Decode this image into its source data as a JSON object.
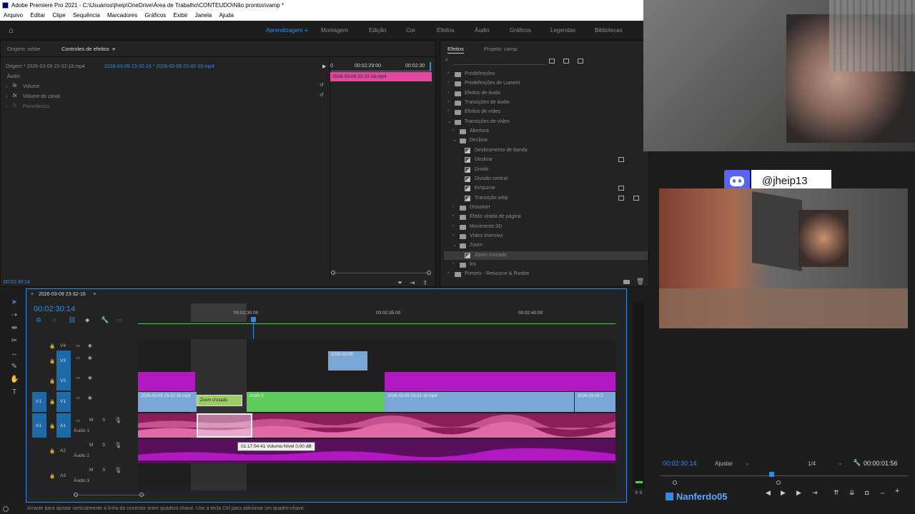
{
  "window": {
    "title": "Adobe Premiere Pro 2021 - C:\\Usuários\\jheip\\OneDrive\\Área de Trabalho\\CONTEUDO\\Não prontos\\vamp *"
  },
  "menu": [
    "Arquivo",
    "Editar",
    "Clipe",
    "Sequência",
    "Marcadores",
    "Gráficos",
    "Exibir",
    "Janela",
    "Ajuda"
  ],
  "workspaces": {
    "active": "Aprendizagem",
    "items": [
      "Montagem",
      "Edição",
      "Cor",
      "Efeitos",
      "Áudio",
      "Gráficos",
      "Legendas",
      "Bibliotecas"
    ]
  },
  "effect_controls": {
    "tab_source": "Origem: white",
    "tab_controls": "Controles de efeitos",
    "source_clip": "Origem * 2026-03-09 23-32-16.mp4",
    "seq_clip": "2026-03-09 23-32-16 * 2026-03-09 23-32-16.mp4",
    "section": "Áudio",
    "rows": [
      "Volume",
      "Volume do canal",
      "Panorâmico"
    ],
    "fx_label": "fx",
    "ruler_start": "0",
    "ruler_mid": "00:02:29:00",
    "ruler_end": "00:02:30",
    "clip_name": "2026-03-09 23-32-16.mp4",
    "time": "00:02:30:14"
  },
  "effects_panel": {
    "tab_effects": "Efeitos",
    "tab_project": "Projeto: vamp",
    "tree": [
      {
        "label": "Predefinições",
        "level": 0,
        "type": "folder",
        "expanded": false
      },
      {
        "label": "Predefinições de Lumetri",
        "level": 0,
        "type": "folder",
        "expanded": false
      },
      {
        "label": "Efeitos de áudio",
        "level": 0,
        "type": "folder",
        "expanded": false
      },
      {
        "label": "Transições de áudio",
        "level": 0,
        "type": "folder",
        "expanded": false
      },
      {
        "label": "Efeitos de vídeo",
        "level": 0,
        "type": "folder",
        "expanded": false
      },
      {
        "label": "Transições de vídeo",
        "level": 0,
        "type": "folder",
        "expanded": true
      },
      {
        "label": "Abertura",
        "level": 1,
        "type": "folder",
        "expanded": false
      },
      {
        "label": "Deslizar",
        "level": 1,
        "type": "folder",
        "expanded": true
      },
      {
        "label": "Deslizamento de banda",
        "level": 2,
        "type": "preset",
        "acc": 0
      },
      {
        "label": "Deslizar",
        "level": 2,
        "type": "preset",
        "acc": 1
      },
      {
        "label": "Dividir",
        "level": 2,
        "type": "preset",
        "acc": 0
      },
      {
        "label": "Divisão central",
        "level": 2,
        "type": "preset",
        "acc": 0
      },
      {
        "label": "Empurrar",
        "level": 2,
        "type": "preset",
        "acc": 1
      },
      {
        "label": "Transição whip",
        "level": 2,
        "type": "preset",
        "acc": 2
      },
      {
        "label": "Dissolver",
        "level": 1,
        "type": "folder",
        "expanded": false
      },
      {
        "label": "Efeito virada de página",
        "level": 1,
        "type": "folder",
        "expanded": false
      },
      {
        "label": "Movimento 3D",
        "level": 1,
        "type": "folder",
        "expanded": false
      },
      {
        "label": "Vídeo imersivo",
        "level": 1,
        "type": "folder",
        "expanded": false
      },
      {
        "label": "Zoom",
        "level": 1,
        "type": "folder",
        "expanded": true
      },
      {
        "label": "Zoom cruzado",
        "level": 2,
        "type": "preset",
        "acc": 0,
        "selected": true
      },
      {
        "label": "Íris",
        "level": 1,
        "type": "folder",
        "expanded": false
      },
      {
        "label": "Presets - Resource & Rookie",
        "level": 0,
        "type": "folder",
        "expanded": false
      }
    ]
  },
  "timeline": {
    "sequence_name": "2026-03-09 23-32-16",
    "timecode": "00:02:30:14",
    "ruler": [
      "00:02:30:00",
      "00:02:35:00",
      "00:02:40:00"
    ],
    "tracks_video": [
      "V4",
      "V3",
      "V2",
      "V1"
    ],
    "tracks_audio": [
      "A1",
      "A2",
      "A3"
    ],
    "audio_names": [
      "Áudio 1",
      "Áudio 2",
      "Áudio 3"
    ],
    "src_v1": "V1",
    "src_a1": "A1",
    "clips": {
      "v3_clip": "2026-03-09",
      "v1_clip_a": "2026-03-09 23-32-16.mp4",
      "v1_transition": "Zoom cruzado",
      "v1_clip_b": "zoom 5",
      "v1_clip_c": "2026-03-09 23-32-16.mp4",
      "v1_clip_d": "2026-03-09 2"
    },
    "tooltip": "01:17:54:41  Volume:Nível  0,00 dB",
    "m_label": "M",
    "s_label": "S",
    "ss_label": "S S"
  },
  "program_monitor": {
    "timecode": "00:02:30:14",
    "fit": "Ajustar",
    "resolution": "1/4",
    "duration": "00:00:01:56"
  },
  "overlay": {
    "discord_handle": "@jheip13",
    "streamer_tag": "Nanferdo05"
  },
  "statusbar": {
    "text": "Arraste para ajustar verticalmente a linha do conector entre quadros-chave. Use a tecla Ctrl para adicionar um quadro-chave."
  },
  "colors": {
    "accent": "#2d8ceb",
    "v1_clip": "#7aa7d6",
    "v1_green": "#5dcc5d",
    "v2_magenta": "#b018c0",
    "audio_pink": "#e06aa8",
    "discord": "#5865f2"
  }
}
